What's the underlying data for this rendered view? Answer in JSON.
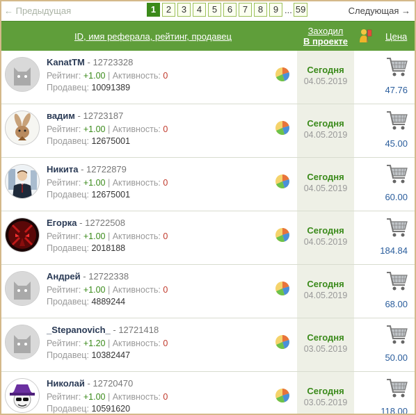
{
  "pagination": {
    "prev_label": "← Предыдущая",
    "next_label": "Следующая →",
    "pages": [
      "1",
      "2",
      "3",
      "4",
      "5",
      "6",
      "7",
      "8",
      "9"
    ],
    "active_page": "1",
    "ellipsis": "...",
    "last_page": "59"
  },
  "header": {
    "main_label": "ID, имя реферала, рейтинг, продавец",
    "visited_line1": "Заходил",
    "visited_line2": "В проекте",
    "price_label": "Цена"
  },
  "labels": {
    "rating": "Рейтинг:",
    "activity": "Активность:",
    "seller": "Продавец:"
  },
  "colors": {
    "header_bg": "#5f9e3a",
    "accent_green": "#3a8a1a",
    "price_blue": "#2a5d9c",
    "activity_red": "#c0392b"
  },
  "rows": [
    {
      "name": "KanatTM",
      "id": "- 12723328",
      "rating": "+1.00",
      "activity": "0",
      "seller": "10091389",
      "day": "Сегодня",
      "date": "04.05.2019",
      "price": "47.76",
      "avatar": "cat-avatar-icon"
    },
    {
      "name": "вадим",
      "id": "- 12723187",
      "rating": "+1.00",
      "activity": "0",
      "seller": "12675001",
      "day": "Сегодня",
      "date": "04.05.2019",
      "price": "45.00",
      "avatar": "rabbit-avatar-icon"
    },
    {
      "name": "Никита",
      "id": "- 12722879",
      "rating": "+1.00",
      "activity": "0",
      "seller": "12675001",
      "day": "Сегодня",
      "date": "04.05.2019",
      "price": "60.00",
      "avatar": "businessman-avatar-icon"
    },
    {
      "name": "Егорка",
      "id": "- 12722508",
      "rating": "+1.00",
      "activity": "0",
      "seller": "2018188",
      "day": "Сегодня",
      "date": "04.05.2019",
      "price": "184.84",
      "avatar": "red-demon-avatar-icon"
    },
    {
      "name": "Андрей",
      "id": "- 12722338",
      "rating": "+1.00",
      "activity": "0",
      "seller": "4889244",
      "day": "Сегодня",
      "date": "04.05.2019",
      "price": "68.00",
      "avatar": "cat-avatar-icon"
    },
    {
      "name": "_Stepanovich_",
      "id": "- 12721418",
      "rating": "+1.20",
      "activity": "0",
      "seller": "10382447",
      "day": "Сегодня",
      "date": "03.05.2019",
      "price": "50.00",
      "avatar": "cat-avatar-icon"
    },
    {
      "name": "Николай",
      "id": "- 12720470",
      "rating": "+1.00",
      "activity": "0",
      "seller": "10591620",
      "day": "Сегодня",
      "date": "03.05.2019",
      "price": "118.00",
      "avatar": "purple-hat-avatar-icon"
    }
  ]
}
